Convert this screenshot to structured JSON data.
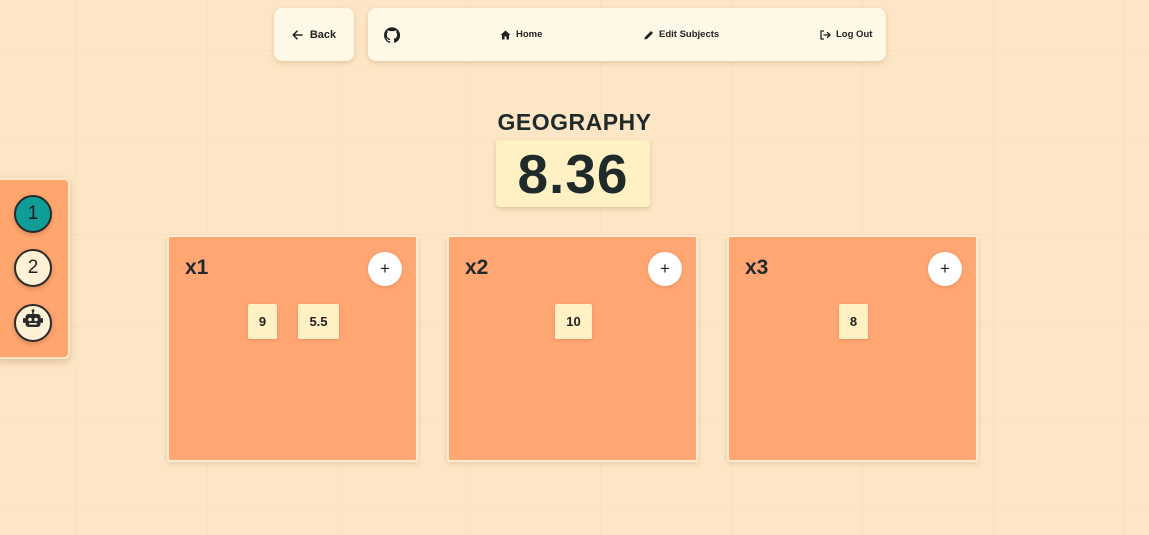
{
  "colors": {
    "background": "#fde6c6",
    "panel": "#fff8e6",
    "card": "#ffa672",
    "chip": "#fff1c4",
    "accent_teal": "#0f9d98",
    "text": "#1f2a2a"
  },
  "back_button": {
    "icon": "arrow-left-icon",
    "label": "Back"
  },
  "nav": {
    "github": {
      "icon": "github-icon"
    },
    "home": {
      "icon": "home-icon",
      "label": "Home"
    },
    "edit_subjects": {
      "icon": "pencil-icon",
      "label": "Edit Subjects"
    },
    "logout": {
      "icon": "logout-icon",
      "label": "Log Out"
    }
  },
  "subject": {
    "title": "GEOGRAPHY",
    "average": "8.36"
  },
  "side_panel": {
    "buttons": [
      {
        "label": "1",
        "active": true
      },
      {
        "label": "2",
        "active": false
      },
      {
        "icon": "robot-icon",
        "active": false
      }
    ]
  },
  "cards": [
    {
      "label": "x1",
      "add_label": "+",
      "grades": [
        "9",
        "5.5"
      ]
    },
    {
      "label": "x2",
      "add_label": "+",
      "grades": [
        "10"
      ]
    },
    {
      "label": "x3",
      "add_label": "+",
      "grades": [
        "8"
      ]
    }
  ]
}
